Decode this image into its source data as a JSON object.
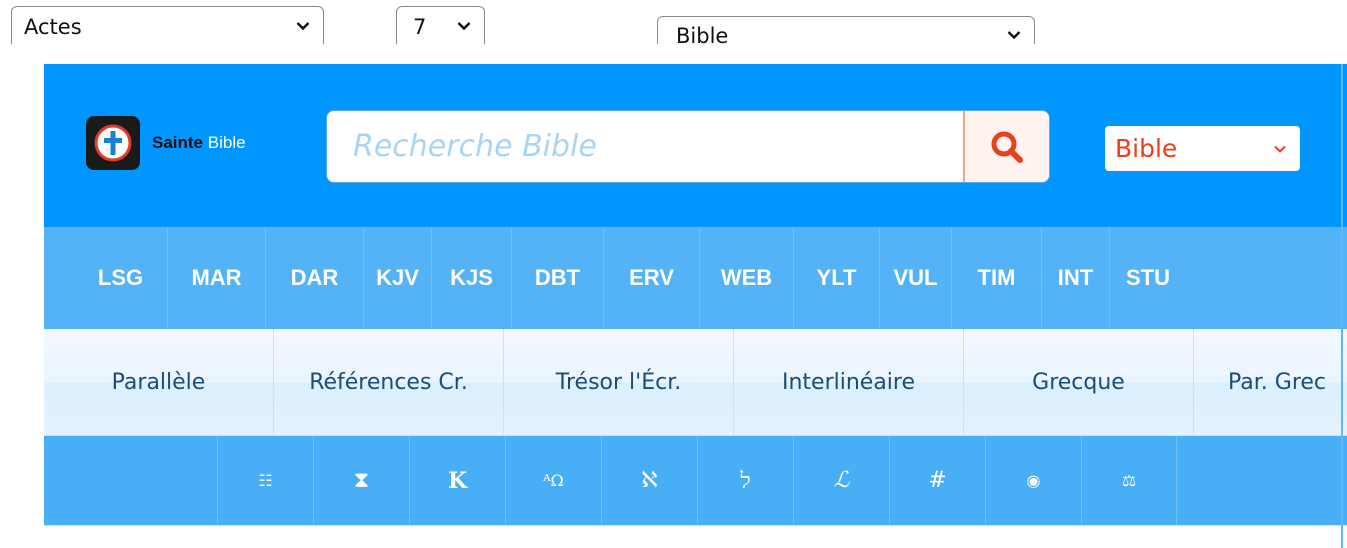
{
  "selectors": {
    "book": "Actes",
    "chapter": "7",
    "version": "Bible"
  },
  "header": {
    "logo_text_bold": "Sainte",
    "logo_text_light": "Bible",
    "search_placeholder": "Recherche Bible",
    "lang_select": "Bible",
    "colors": {
      "header_bg": "#0096ff",
      "accent": "#e8401c"
    }
  },
  "versions": [
    "LSG",
    "MAR",
    "DAR",
    "KJV",
    "KJS",
    "DBT",
    "ERV",
    "WEB",
    "YLT",
    "VUL",
    "TIM",
    "INT",
    "STU"
  ],
  "tools": [
    "Parallèle",
    "Références Cr.",
    "Trésor l'Écr.",
    "Interlinéaire",
    "Grecque",
    "Par. Grec"
  ],
  "icon_bar": [
    {
      "name": "list-icon",
      "glyph": "☷"
    },
    {
      "name": "hourglass-icon",
      "glyph": "⧗"
    },
    {
      "name": "k-icon",
      "glyph": "K"
    },
    {
      "name": "alpha-omega-icon",
      "glyph": "ᴬΩ"
    },
    {
      "name": "aleph-icon",
      "glyph": "ℵ"
    },
    {
      "name": "hebrew-icon",
      "glyph": "ﬥ"
    },
    {
      "name": "script-l-icon",
      "glyph": "ℒ"
    },
    {
      "name": "hash-icon",
      "glyph": "#"
    },
    {
      "name": "globe-icon",
      "glyph": "◉"
    },
    {
      "name": "balance-icon",
      "glyph": "⚖"
    }
  ]
}
